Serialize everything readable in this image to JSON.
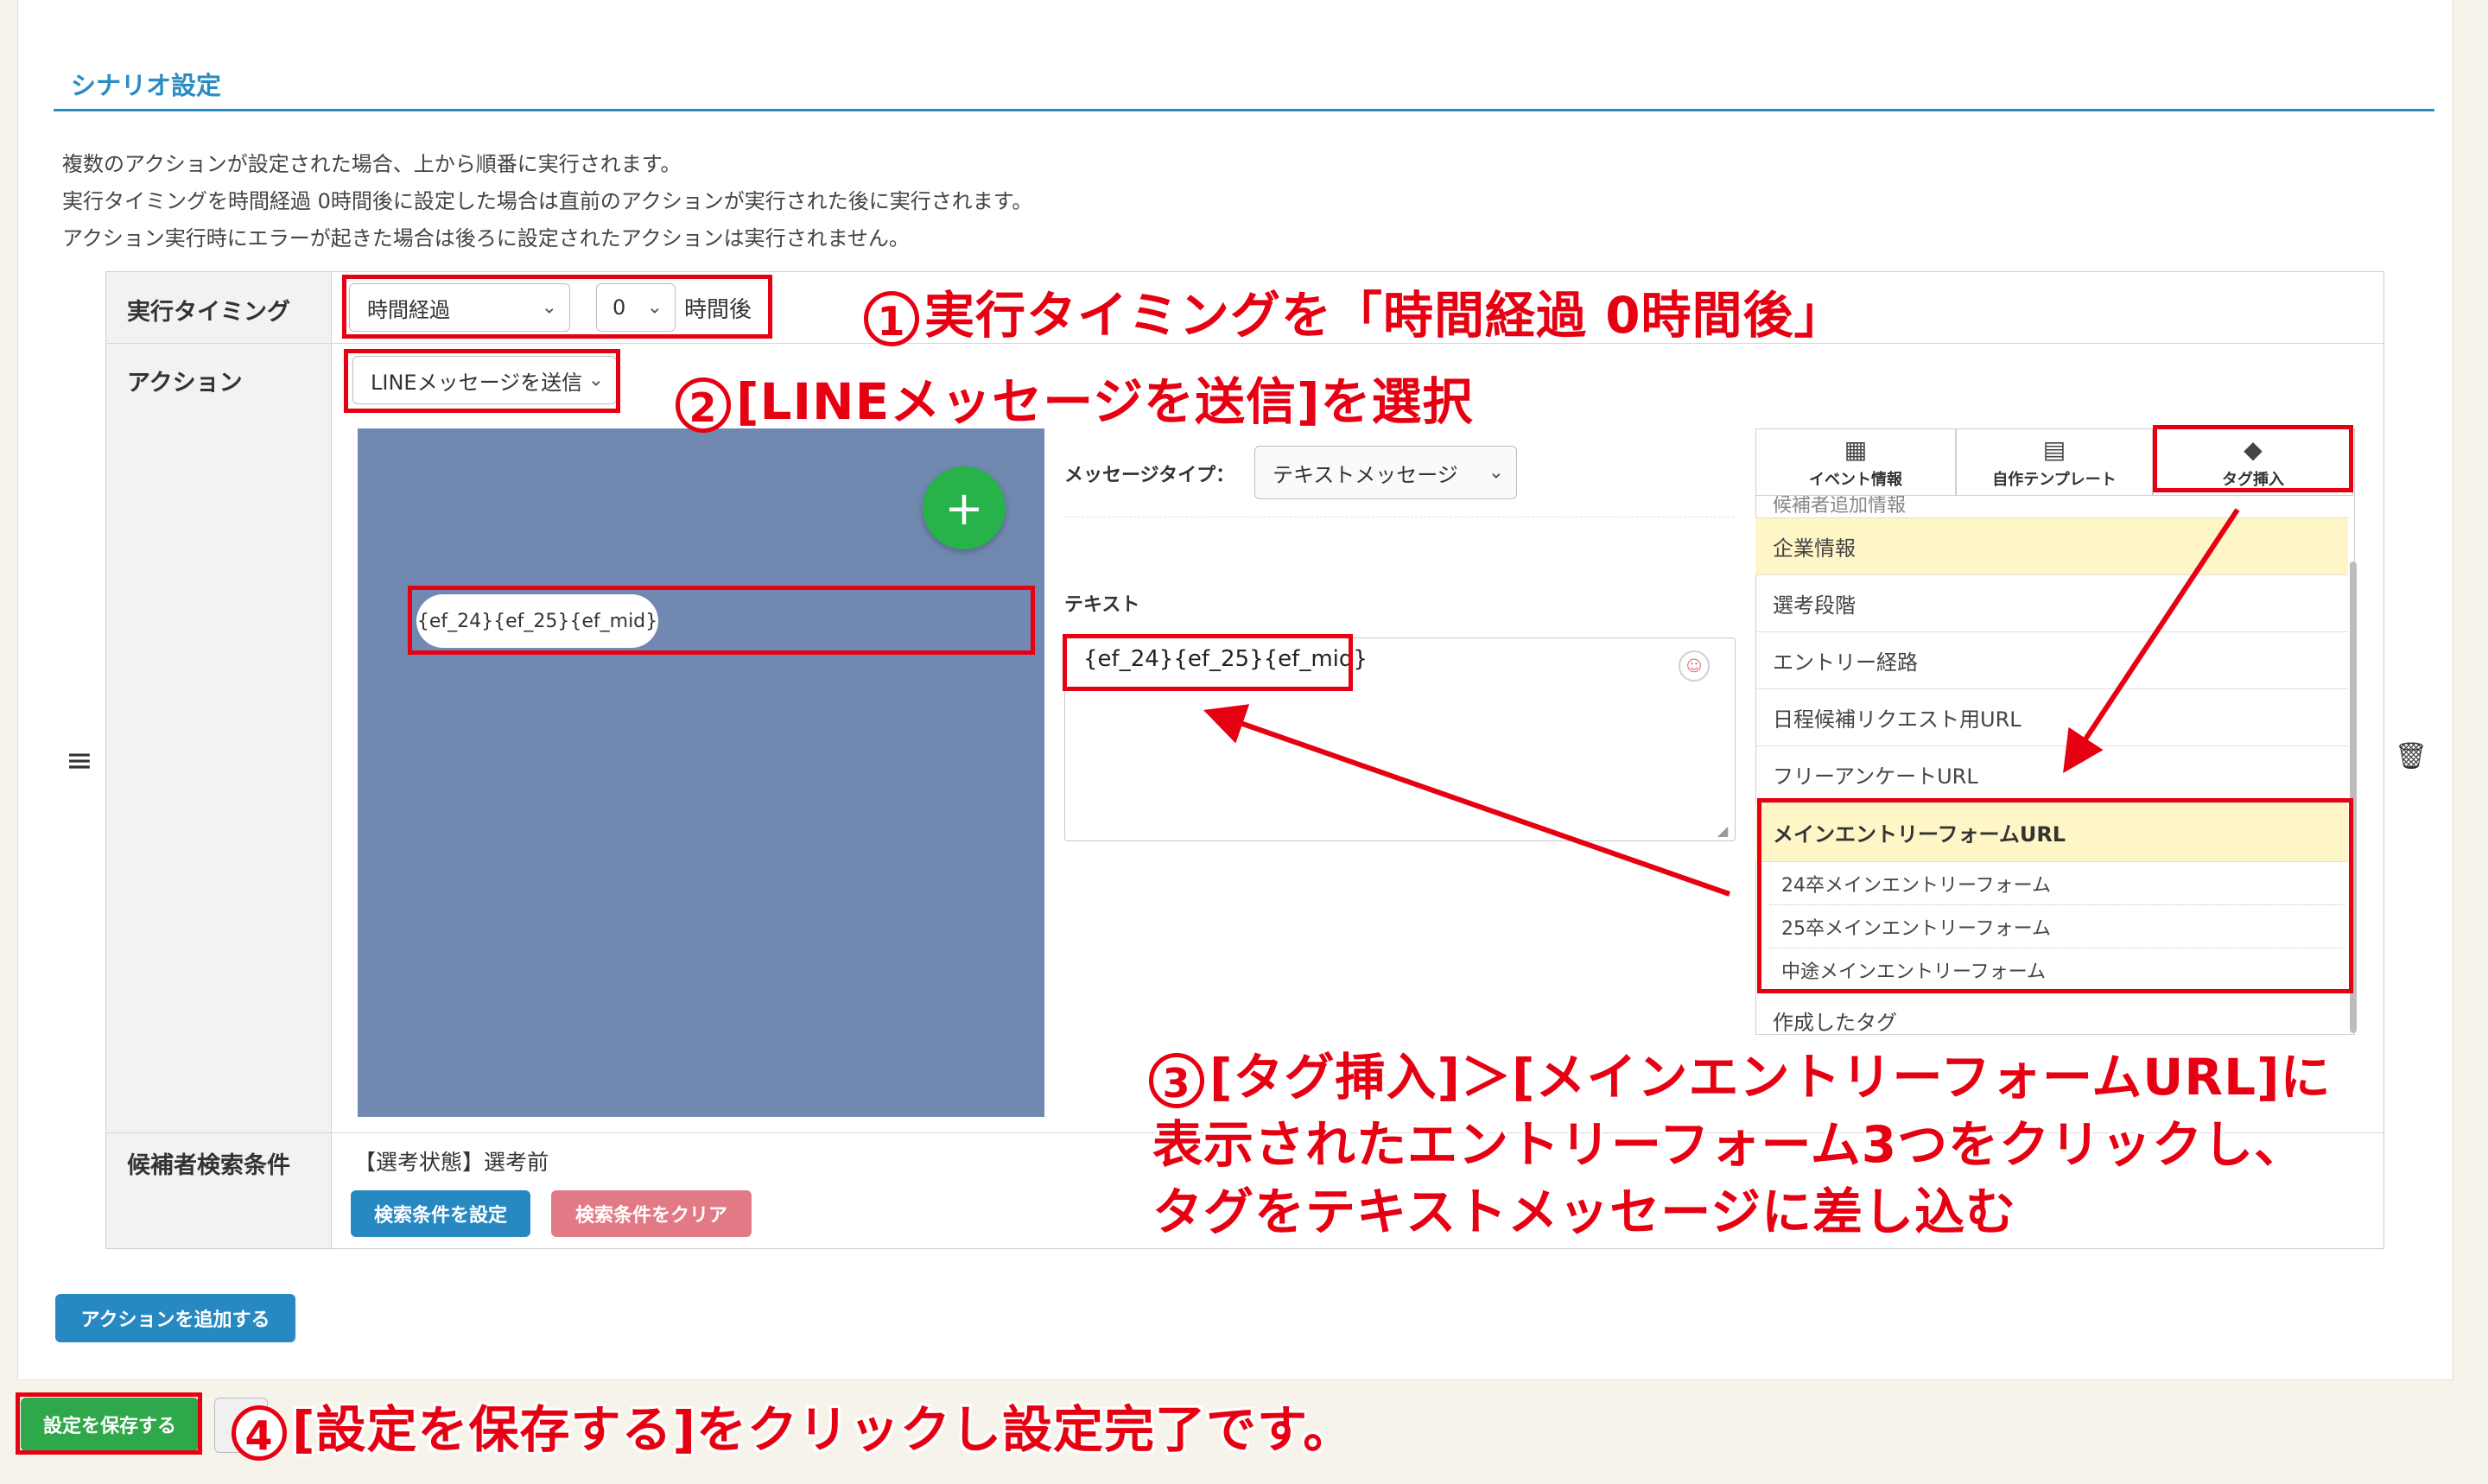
{
  "header": {
    "title": "シナリオ設定"
  },
  "description": [
    "複数のアクションが設定された場合、上から順番に実行されます。",
    "実行タイミングを時間経過 0時間後に設定した場合は直前のアクションが実行された後に実行されます。",
    "アクション実行時にエラーが起きた場合は後ろに設定されたアクションは実行されません。"
  ],
  "rows": {
    "timing": {
      "label": "実行タイミング",
      "type_value": "時間経過",
      "hours_value": "0",
      "hours_suffix": "時間後"
    },
    "action": {
      "label": "アクション",
      "value": "LINEメッセージを送信"
    },
    "search": {
      "label": "候補者検索条件",
      "condition": "【選考状態】選考前",
      "set_button": "検索条件を設定",
      "clear_button": "検索条件をクリア"
    }
  },
  "editor": {
    "message_type_label": "メッセージタイプ：",
    "message_type_value": "テキストメッセージ",
    "text_label": "テキスト",
    "text_value": "{ef_24}{ef_25}{ef_mid}",
    "preview_bubble": "{ef_24}{ef_25}{ef_mid}"
  },
  "tag_panel": {
    "tabs": [
      {
        "label": "イベント情報",
        "icon": "calendar-icon"
      },
      {
        "label": "自作テンプレート",
        "icon": "template-icon"
      },
      {
        "label": "タグ挿入",
        "icon": "tag-icon"
      }
    ],
    "partial_item": "候補者追加情報",
    "items": [
      "企業情報",
      "選考段階",
      "エントリー経路",
      "日程候補リクエスト用URL",
      "フリーアンケートURL"
    ],
    "expanded": {
      "title": "メインエントリーフォームURL",
      "children": [
        "24卒メインエントリーフォーム",
        "25卒メインエントリーフォーム",
        "中途メインエントリーフォーム"
      ]
    },
    "last_item": "作成したタグ"
  },
  "buttons": {
    "add_action": "アクションを追加する",
    "save": "設定を保存する"
  },
  "annotations": {
    "a1_num": "1",
    "a1": "実行タイミングを「時間経過 0時間後」",
    "a2_num": "2",
    "a2": "[LINEメッセージを送信]を選択",
    "a3_num": "3",
    "a3_line1": "[タグ挿入]＞[メインエントリーフォームURL]に",
    "a3_line2": "表示されたエントリーフォーム3つをクリックし、",
    "a3_line3": "タグをテキストメッセージに差し込む",
    "a4_num": "4",
    "a4": "[設定を保存する]をクリックし設定完了です。"
  },
  "colors": {
    "accent": "#2a8cc3",
    "annotation_red": "#e60012",
    "highlight_yellow": "#fff6c7",
    "preview_bg": "#7189b1",
    "fab_green": "#27b24a"
  }
}
